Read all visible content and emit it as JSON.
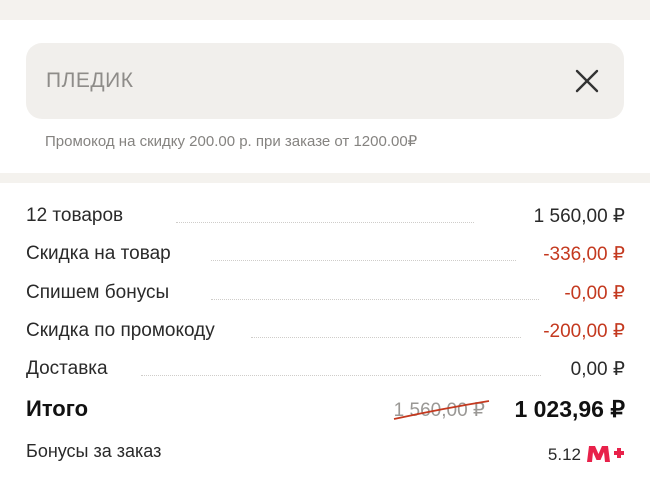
{
  "promo": {
    "code": "ПЛЕДИК",
    "hint": "Промокод на скидку 200.00 р. при заказе от 1200.00₽"
  },
  "summary": {
    "rows": [
      {
        "label": "12 товаров",
        "value": "1 560,00 ₽"
      },
      {
        "label": "Скидка на товар",
        "value": "-336,00 ₽"
      },
      {
        "label": "Спишем бонусы",
        "value": "-0,00 ₽"
      },
      {
        "label": "Скидка по промокоду",
        "value": "-200,00 ₽"
      },
      {
        "label": "Доставка",
        "value": "0,00 ₽"
      }
    ],
    "total": {
      "label": "Итого",
      "old_price": "1 560,00 ₽",
      "value": "1 023,96 ₽"
    },
    "bonus": {
      "label": "Бонусы за заказ",
      "value": "5.12",
      "logo_icon": "m-plus-logo-icon"
    }
  },
  "colors": {
    "discount": "#c4391f",
    "brand": "#e8214a"
  }
}
